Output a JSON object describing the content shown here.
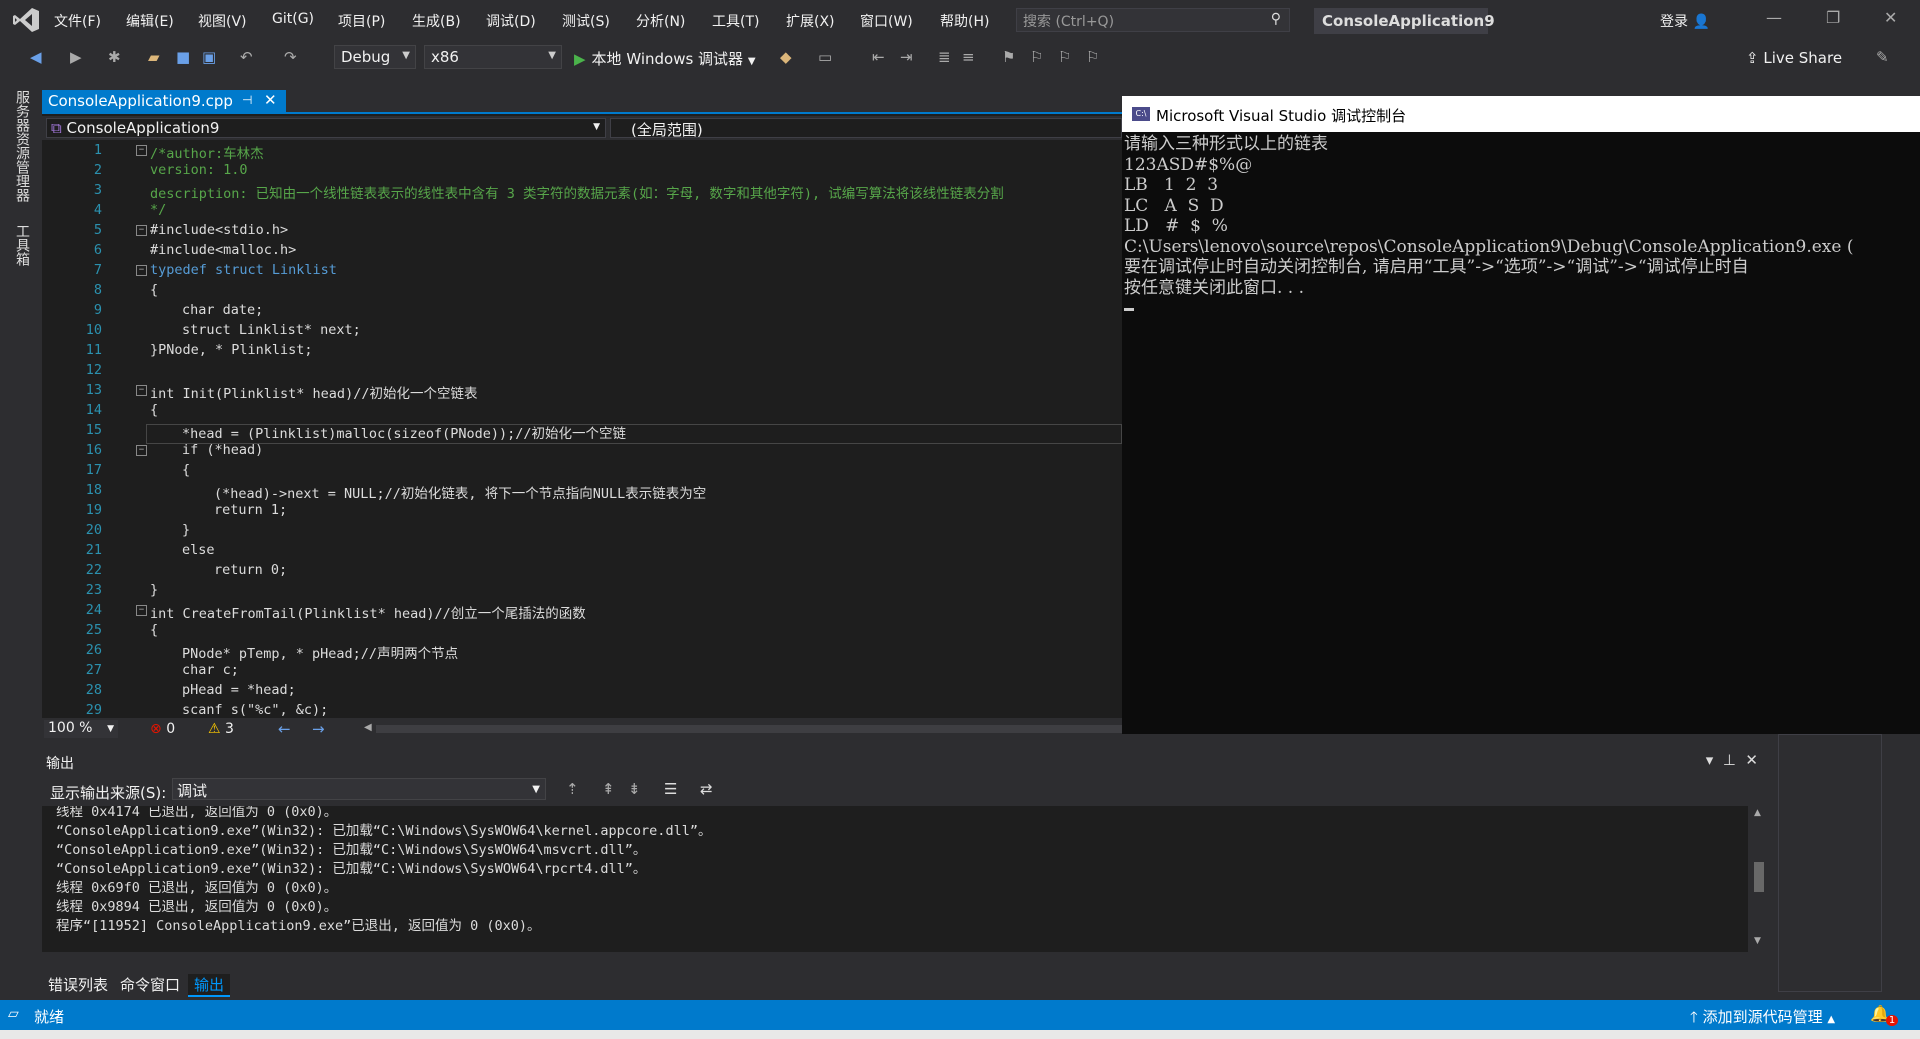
{
  "menubar": {
    "items": [
      "文件(F)",
      "编辑(E)",
      "视图(V)",
      "Git(G)",
      "项目(P)",
      "生成(B)",
      "调试(D)",
      "测试(S)",
      "分析(N)",
      "工具(T)",
      "扩展(X)",
      "窗口(W)",
      "帮助(H)"
    ],
    "search_placeholder": "搜索 (Ctrl+Q)",
    "solution_name": "ConsoleApplication9",
    "login_label": "登录"
  },
  "toolbar": {
    "config": "Debug",
    "platform": "x86",
    "run_label": "本地 Windows 调试器",
    "liveshare_label": "Live Share"
  },
  "left_rail": {
    "items": [
      "服务器资源管理器",
      "工具箱"
    ]
  },
  "editor": {
    "tab_label": "ConsoleApplication9.cpp",
    "nav_project": "ConsoleApplication9",
    "nav_scope": "(全局范围)",
    "zoom": "100 %",
    "error_count": "0",
    "warning_count": "3"
  },
  "code_lines": [
    {
      "n": "1",
      "t": "/*author:车林杰",
      "c": "cmt",
      "fold": "−",
      "indent": 0
    },
    {
      "n": "2",
      "t": "version: 1.0",
      "c": "cmt",
      "fold": "",
      "indent": 0
    },
    {
      "n": "3",
      "t": "description: 已知由一个线性链表表示的线性表中含有 3 类字符的数据元素(如：字母, 数字和其他字符), 试编写算法将该线性链表分割",
      "c": "cmt",
      "fold": "",
      "indent": 0
    },
    {
      "n": "4",
      "t": "*/",
      "c": "cmt",
      "fold": "",
      "indent": 0
    },
    {
      "n": "5",
      "t": "#include<stdio.h>",
      "c": "txt",
      "fold": "−",
      "indent": 0
    },
    {
      "n": "6",
      "t": "#include<malloc.h>",
      "c": "txt",
      "fold": "",
      "indent": 0
    },
    {
      "n": "7",
      "t": "typedef struct Linklist",
      "c": "kw",
      "fold": "−",
      "indent": 0
    },
    {
      "n": "8",
      "t": "{",
      "c": "txt",
      "fold": "",
      "indent": 0
    },
    {
      "n": "9",
      "t": "char date;",
      "c": "txt",
      "fold": "",
      "indent": 2
    },
    {
      "n": "10",
      "t": "struct Linklist* next;",
      "c": "txt",
      "fold": "",
      "indent": 2
    },
    {
      "n": "11",
      "t": "}PNode, * Plinklist;",
      "c": "txt",
      "fold": "",
      "indent": 0
    },
    {
      "n": "12",
      "t": "",
      "c": "txt",
      "fold": "",
      "indent": 0
    },
    {
      "n": "13",
      "t": "int Init(Plinklist* head)//初始化一个空链表",
      "c": "txt",
      "fold": "−",
      "indent": 0
    },
    {
      "n": "14",
      "t": "{",
      "c": "txt",
      "fold": "",
      "indent": 0
    },
    {
      "n": "15",
      "t": "*head = (Plinklist)malloc(sizeof(PNode));//初始化一个空链",
      "c": "txt",
      "fold": "",
      "indent": 2
    },
    {
      "n": "16",
      "t": "if (*head)",
      "c": "txt",
      "fold": "−",
      "indent": 2
    },
    {
      "n": "17",
      "t": "{",
      "c": "txt",
      "fold": "",
      "indent": 2
    },
    {
      "n": "18",
      "t": "(*head)->next = NULL;//初始化链表, 将下一个节点指向NULL表示链表为空",
      "c": "txt",
      "fold": "",
      "indent": 4
    },
    {
      "n": "19",
      "t": "return 1;",
      "c": "txt",
      "fold": "",
      "indent": 4
    },
    {
      "n": "20",
      "t": "}",
      "c": "txt",
      "fold": "",
      "indent": 2
    },
    {
      "n": "21",
      "t": "else",
      "c": "txt",
      "fold": "",
      "indent": 2
    },
    {
      "n": "22",
      "t": "return 0;",
      "c": "txt",
      "fold": "",
      "indent": 4
    },
    {
      "n": "23",
      "t": "}",
      "c": "txt",
      "fold": "",
      "indent": 0
    },
    {
      "n": "24",
      "t": "int CreateFromTail(Plinklist* head)//创立一个尾插法的函数",
      "c": "txt",
      "fold": "−",
      "indent": 0
    },
    {
      "n": "25",
      "t": "{",
      "c": "txt",
      "fold": "",
      "indent": 0
    },
    {
      "n": "26",
      "t": "PNode* pTemp, * pHead;//声明两个节点",
      "c": "txt",
      "fold": "",
      "indent": 2
    },
    {
      "n": "27",
      "t": "char c;",
      "c": "txt",
      "fold": "",
      "indent": 2
    },
    {
      "n": "28",
      "t": "pHead = *head;",
      "c": "txt",
      "fold": "",
      "indent": 2
    },
    {
      "n": "29",
      "t": "scanf_s(\"%c\", &c);",
      "c": "txt",
      "fold": "",
      "indent": 2
    }
  ],
  "console": {
    "title": "Microsoft Visual Studio 调试控制台",
    "icon_label": "C:\\",
    "lines": [
      "请输入三种形式以上的链表",
      "123ASD#$%@",
      "LB   1  2  3",
      "LC   A  S  D",
      "LD   #  $  %",
      "C:\\Users\\lenovo\\source\\repos\\ConsoleApplication9\\Debug\\ConsoleApplication9.exe (",
      "要在调试停止时自动关闭控制台, 请启用“工具”->“选项”->“调试”->“调试停止时自",
      "按任意键关闭此窗口. . ."
    ]
  },
  "output": {
    "title": "输出",
    "source_label": "显示输出来源(S):",
    "source_value": "调试",
    "lines": [
      "线程 0x4174 已退出, 返回值为 0 (0x0)。",
      "“ConsoleApplication9.exe”(Win32): 已加载“C:\\Windows\\SysWOW64\\kernel.appcore.dll”。",
      "“ConsoleApplication9.exe”(Win32): 已加载“C:\\Windows\\SysWOW64\\msvcrt.dll”。",
      "“ConsoleApplication9.exe”(Win32): 已加载“C:\\Windows\\SysWOW64\\rpcrt4.dll”。",
      "线程 0x69f0 已退出, 返回值为 0 (0x0)。",
      "线程 0x9894 已退出, 返回值为 0 (0x0)。",
      "程序“[11952] ConsoleApplication9.exe”已退出, 返回值为 0 (0x0)。"
    ],
    "tabs": [
      "错误列表",
      "命令窗口",
      "输出"
    ]
  },
  "statusbar": {
    "ready": "就绪",
    "source_control": "添加到源代码管理",
    "notification_count": "1"
  }
}
